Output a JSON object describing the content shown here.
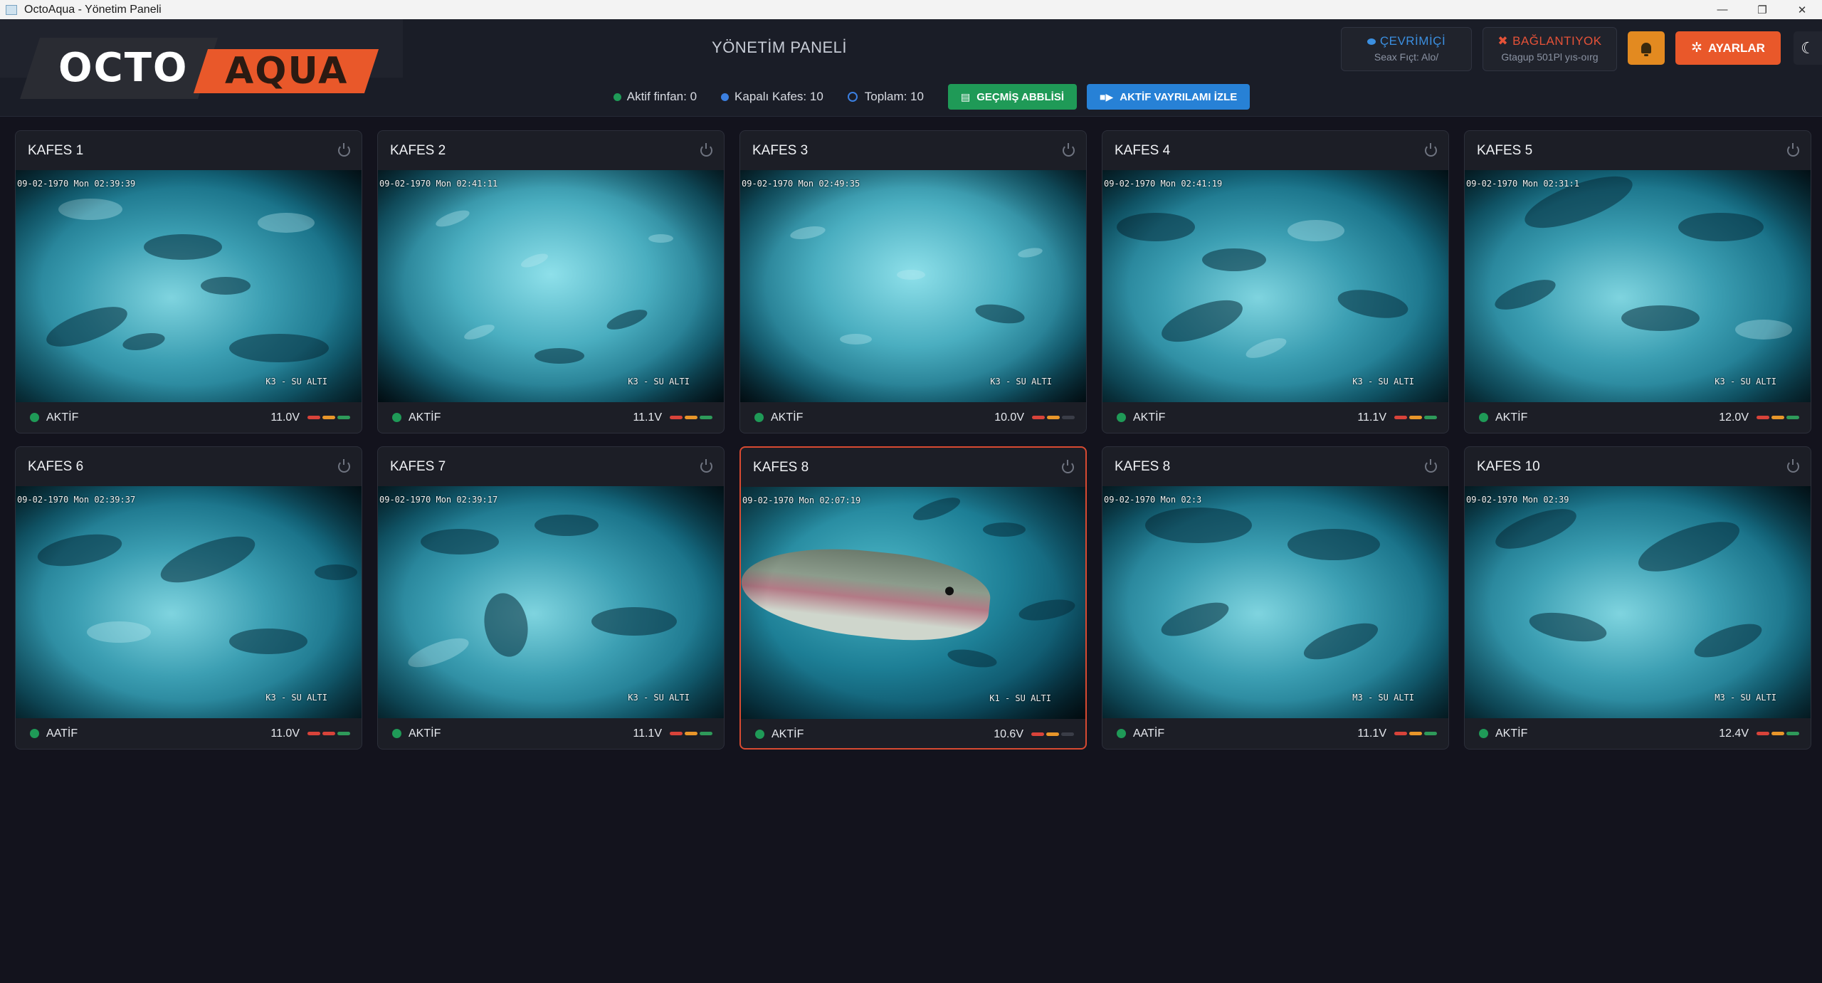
{
  "window": {
    "title": "OctoAqua - Yönetim Paneli",
    "minimize": "—",
    "restore": "❐",
    "close": "✕"
  },
  "logo": {
    "part1": "OCTO",
    "part2": "AQUA"
  },
  "header": {
    "page_title": "YÖNETİM PANELİ",
    "online": {
      "label": "ÇEVRİMİÇİ",
      "sub": "Seax Fıçt: Alo/"
    },
    "connection": {
      "label": "BAĞLANTIYOK",
      "sub": "Gtagup 501Pl yıs-oırg"
    },
    "settings_label": "AYARLAR",
    "theme_icon": "☾",
    "gear_icon": "✲"
  },
  "stats": {
    "active": "Aktif finfan: 0",
    "closed": "Kapalı Kafes: 10",
    "total": "Toplam: 10",
    "history_button": "GEÇMİŞ ABBLİSİ",
    "live_button": "AKTİF VAYRILAMI İZLE",
    "colors": {
      "active": "#1f9a57",
      "closed": "#3b7fe0",
      "history": "#1f9a57",
      "live": "#2781d6"
    }
  },
  "cages": [
    {
      "name": "KAFES 1",
      "timestamp": "09-02-1970 Mon 02:39:39",
      "cam": "K3 - SU ALTI",
      "status": "AKTİF",
      "voltage": "11.0V",
      "bars": [
        "red",
        "amb",
        "grn"
      ],
      "selected": false
    },
    {
      "name": "KAFES 2",
      "timestamp": "09-02-1970 Mon 02:41:11",
      "cam": "K3 - SU ALTI",
      "status": "AKTİF",
      "voltage": "11.1V",
      "bars": [
        "red",
        "amb",
        "grn"
      ],
      "selected": false
    },
    {
      "name": "KAFES 3",
      "timestamp": "09-02-1970 Mon 02:49:35",
      "cam": "K3 - SU ALTI",
      "status": "AKTİF",
      "voltage": "10.0V",
      "bars": [
        "red",
        "amb",
        "off"
      ],
      "selected": false
    },
    {
      "name": "KAFES 4",
      "timestamp": "09-02-1970 Mon 02:41:19",
      "cam": "K3 - SU ALTI",
      "status": "AKTİF",
      "voltage": "11.1V",
      "bars": [
        "red",
        "amb",
        "grn"
      ],
      "selected": false
    },
    {
      "name": "KAFES 5",
      "timestamp": "09-02-1970 Mon 02:31:1",
      "cam": "K3 - SU ALTI",
      "status": "AKTİF",
      "voltage": "12.0V",
      "bars": [
        "red",
        "amb",
        "grn"
      ],
      "selected": false
    },
    {
      "name": "KAFES 6",
      "timestamp": "09-02-1970 Mon 02:39:37",
      "cam": "K3 - SU ALTI",
      "status": "AATİF",
      "voltage": "11.0V",
      "bars": [
        "red",
        "red",
        "grn"
      ],
      "selected": false
    },
    {
      "name": "KAFES 7",
      "timestamp": "09-02-1970 Mon 02:39:17",
      "cam": "K3 - SU ALTI",
      "status": "AKTİF",
      "voltage": "11.1V",
      "bars": [
        "red",
        "amb",
        "grn"
      ],
      "selected": false
    },
    {
      "name": "KAFES 8",
      "timestamp": "09-02-1970 Mon 02:07:19",
      "cam": "K1 - SU ALTI",
      "status": "AKTİF",
      "voltage": "10.6V",
      "bars": [
        "red",
        "amb",
        "off"
      ],
      "selected": true
    },
    {
      "name": "KAFES 8",
      "timestamp": "09-02-1970 Mon 02:3",
      "cam": "M3 - SU ALTI",
      "status": "AATİF",
      "voltage": "11.1V",
      "bars": [
        "red",
        "amb",
        "grn"
      ],
      "selected": false
    },
    {
      "name": "KAFES 10",
      "timestamp": "09-02-1970 Mon 02:39",
      "cam": "M3 - SU ALTI",
      "status": "AKTİF",
      "voltage": "12.4V",
      "bars": [
        "red",
        "amb",
        "grn"
      ],
      "selected": false
    }
  ],
  "colors": {
    "accent": "#e9582a",
    "warning": "#e38a20",
    "ok": "#1f9a57",
    "selected_border": "#d84a31"
  }
}
